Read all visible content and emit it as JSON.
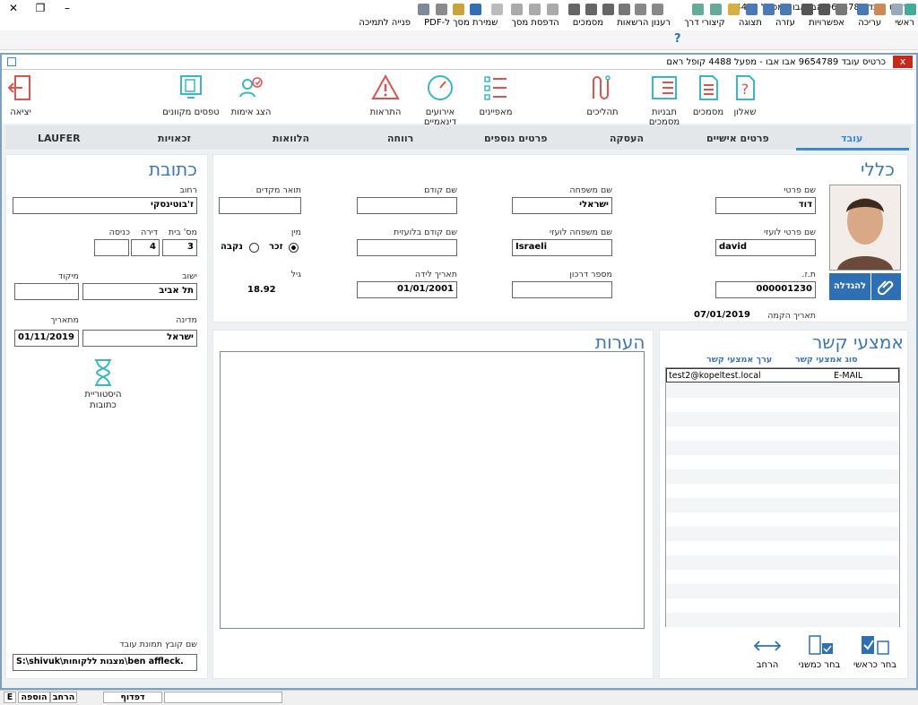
{
  "window": {
    "title": "כרטיס עובד 9654789 אבו אבו - מפעל 4488"
  },
  "menu": [
    "ראשי",
    "עריכה",
    "אפשרויות",
    "עזרה",
    "תצוגה",
    "קיצורי דרך",
    "רענון הרשאות",
    "מסמכים",
    "הדפסת מסך",
    "שמירת מסך ל-PDF",
    "פנייה לתמיכה"
  ],
  "inner_window": {
    "title": "כרטיס עובד 9654789 אבו אבו - מפעל 4488 קופל ראם",
    "close": "x"
  },
  "ribbon": {
    "exit": "יציאה",
    "forms": "טפסים מקוונים",
    "show_auth": "הצג אימות",
    "alerts": "התראות",
    "dynamic": "אירועים דינאמיים",
    "features": "מאפיינים",
    "processes": "תהליכים",
    "templates": "תבניות מסמכים",
    "documents": "מסמכים",
    "questionnaire": "שאלון"
  },
  "tabs": [
    "עובד",
    "פרטים אישיים",
    "העסקה",
    "פרטים נוספים",
    "רווחה",
    "הלוואות",
    "זכאויות",
    "LAUFER"
  ],
  "general": {
    "heading": "כללי",
    "first_name_label": "שם פרטי",
    "first_name": "דוד",
    "last_name_label": "שם משפחה",
    "last_name": "ישראלי",
    "prev_name_label": "שם קודם",
    "prev_name": "",
    "title_label": "תואר מקדים",
    "title": "",
    "first_name_foreign_label": "שם פרטי לועזי",
    "first_name_foreign": "david",
    "last_name_foreign_label": "שם משפחה לועזי",
    "last_name_foreign": "Israeli",
    "prev_name_foreign_label": "שם קודם בלועזית",
    "prev_name_foreign": "",
    "gender_label": "מין",
    "male": "זכר",
    "female": "נקבה",
    "id_label": "ת.ז.",
    "id": "000001230",
    "passport_label": "מספר דרכון",
    "passport": "",
    "birth_label": "תאריך לידה",
    "birth": "01/01/2001",
    "age_label": "גיל",
    "age": "18.92",
    "created_label": "תאריך הקמה",
    "created": "07/01/2019",
    "enlarge": "להגדלה"
  },
  "address": {
    "heading": "כתובת",
    "street_label": "רחוב",
    "street": "ז'בוטינסקי",
    "house_label": "מס' בית",
    "house": "3",
    "apt_label": "דירה",
    "apt": "4",
    "entrance_label": "כניסה",
    "entrance": "",
    "city_label": "ישוב",
    "city": "תל אביב",
    "zip_label": "מיקוד",
    "zip": "",
    "country_label": "מדינה",
    "country": "ישראל",
    "from_label": "מתאריך",
    "from": "01/11/2019",
    "history": "היסטוריית כתובות",
    "photo_file_label": "שם קובץ תמונת עובד",
    "photo_file": "S:\\shivuk\\מצגות ללקוחות\\ben affleck."
  },
  "notes": {
    "heading": "הערות"
  },
  "contact": {
    "heading": "אמצעי קשר",
    "col_type": "סוג אמצעי קשר",
    "col_value": "ערך אמצעי קשר",
    "rows": [
      {
        "type": "E-MAIL",
        "value": "test2@kopeltest.local"
      }
    ],
    "select_first": "בחר כראשי",
    "select_secondary": "בחר כמשני",
    "expand": "הרחב"
  },
  "status": {
    "browse": "דפדוף",
    "expand": "הרחב",
    "add": "הוספה",
    "e": "E"
  },
  "colors": {
    "accent": "#3a8ad8",
    "heading": "#3f75b0",
    "alert": "#d9534f",
    "icon": "#3bb6c4"
  }
}
